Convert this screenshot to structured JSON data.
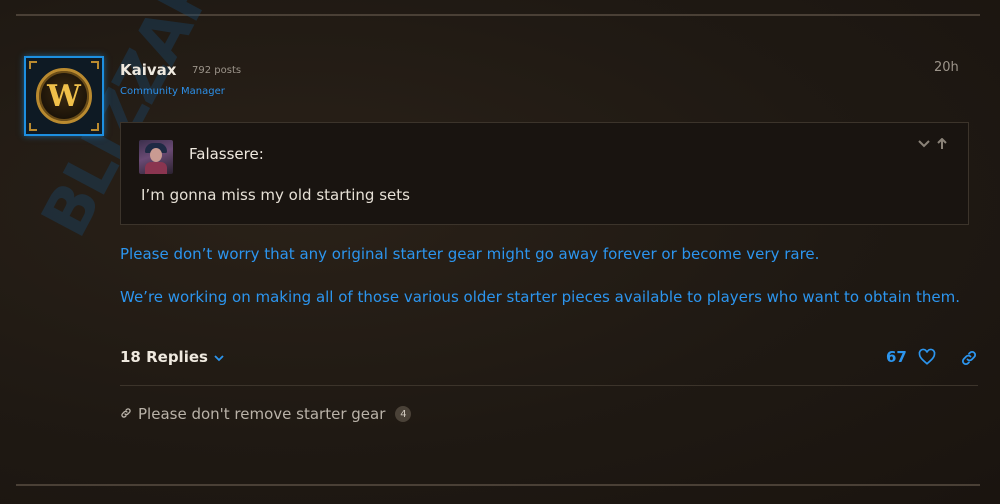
{
  "post": {
    "username": "Kaivax",
    "post_count": "792 posts",
    "role": "Community Manager",
    "time": "20h",
    "avatar_letter": "W",
    "watermark": "BLIZZARD"
  },
  "quote": {
    "author": "Falassere:",
    "text": "I’m gonna miss my old starting sets"
  },
  "body": {
    "paragraphs": [
      "Please don’t worry that any original starter gear might go away forever or become very rare.",
      "We’re working on making all of those various older starter pieces available to players who want to obtain them."
    ]
  },
  "footer": {
    "replies_label": "18 Replies",
    "like_count": "67"
  },
  "related": {
    "title": "Please don't remove starter gear",
    "count": "4"
  },
  "colors": {
    "accent_blue": "#2c95ee",
    "role_blue": "#2c8fe8",
    "background": "#1f1913"
  },
  "icons": [
    "chevron-down-icon",
    "arrow-up-icon",
    "heart-icon",
    "link-icon",
    "chain-icon"
  ]
}
